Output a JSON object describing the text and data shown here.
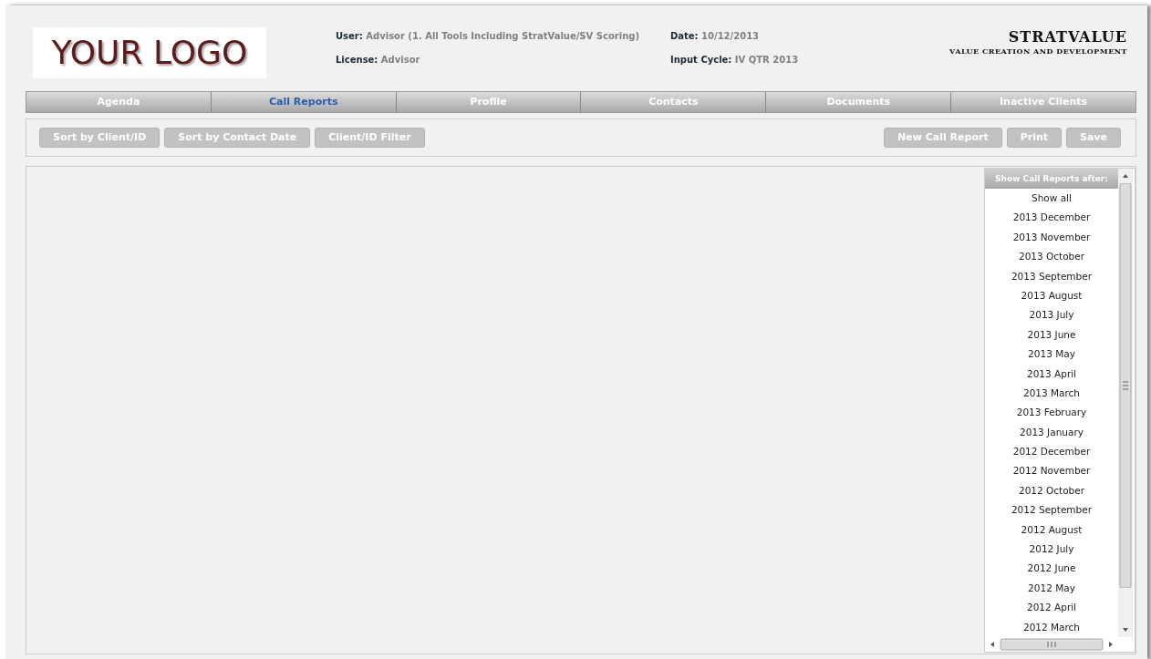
{
  "logo": {
    "text": "YOUR LOGO"
  },
  "user_info": [
    {
      "label": "User:",
      "value": "Advisor (1. All Tools Including StratValue/SV Scoring)"
    },
    {
      "label": "License:",
      "value": "Advisor"
    }
  ],
  "cycle_info": [
    {
      "label": "Date:",
      "value": "10/12/2013"
    },
    {
      "label": "Input Cycle:",
      "value": "IV QTR 2013"
    }
  ],
  "brand": {
    "title": "STRATVALUE",
    "subtitle": "VALUE CREATION AND DEVELOPMENT"
  },
  "tabs": [
    {
      "label": "Agenda",
      "selected": false
    },
    {
      "label": "Call Reports",
      "selected": true
    },
    {
      "label": "Profile",
      "selected": false
    },
    {
      "label": "Contacts",
      "selected": false
    },
    {
      "label": "Documents",
      "selected": false
    },
    {
      "label": "Inactive Clients",
      "selected": false
    }
  ],
  "toolbar_left": [
    "Sort by Client/ID",
    "Sort by Contact Date",
    "Client/ID Filter"
  ],
  "toolbar_right": [
    "New Call Report",
    "Print",
    "Save"
  ],
  "filter_list": {
    "header": "Show Call Reports after:",
    "items": [
      "Show all",
      "2013 December",
      "2013 November",
      "2013 October",
      "2013 September",
      "2013 August",
      "2013 July",
      "2013 June",
      "2013 May",
      "2013 April",
      "2013 March",
      "2013 February",
      "2013 January",
      "2012 December",
      "2012 November",
      "2012 October",
      "2012 September",
      "2012 August",
      "2012 July",
      "2012 June",
      "2012 May",
      "2012 April",
      "2012 March"
    ]
  }
}
